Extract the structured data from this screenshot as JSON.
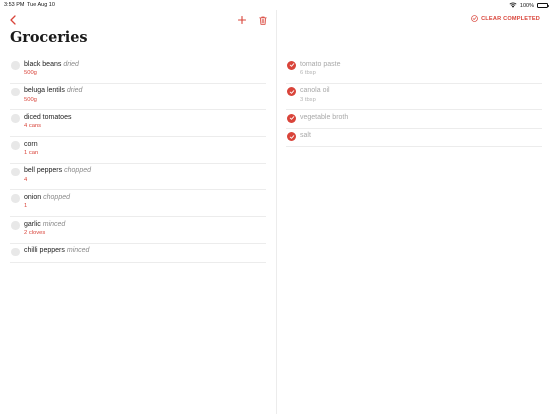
{
  "status_bar": {
    "time": "3:53 PM",
    "date": "Tue Aug 10",
    "battery": "100%"
  },
  "toolbar": {
    "back_icon": "chevron-left-icon",
    "add_icon": "plus-icon",
    "delete_icon": "trash-icon",
    "clear_label": "CLEAR COMPLETED"
  },
  "page": {
    "title": "Groceries"
  },
  "colors": {
    "accent": "#d9443a",
    "completed_text": "#a8a8a8",
    "unchecked_circle": "#e8e8e8"
  },
  "items": [
    {
      "name": "black beans",
      "prep": "dried",
      "qty": "500g"
    },
    {
      "name": "beluga lentils",
      "prep": "dried",
      "qty": "500g"
    },
    {
      "name": "diced tomatoes",
      "prep": "",
      "qty": "4 cans"
    },
    {
      "name": "corn",
      "prep": "",
      "qty": "1 can"
    },
    {
      "name": "bell peppers",
      "prep": "chopped",
      "qty": "4"
    },
    {
      "name": "onion",
      "prep": "chopped",
      "qty": "1"
    },
    {
      "name": "garlic",
      "prep": "minced",
      "qty": "2 cloves"
    },
    {
      "name": "chilli peppers",
      "prep": "minced",
      "qty": ""
    }
  ],
  "completed": [
    {
      "name": "tomato paste",
      "qty": "6 tbsp"
    },
    {
      "name": "canola oil",
      "qty": "3 tbsp"
    },
    {
      "name": "vegetable broth",
      "qty": ""
    },
    {
      "name": "salt",
      "qty": ""
    }
  ]
}
